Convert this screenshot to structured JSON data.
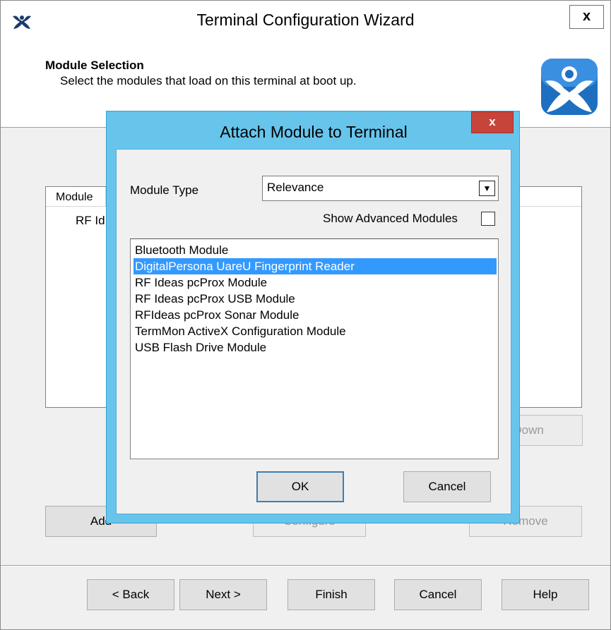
{
  "wizard": {
    "title": "Terminal Configuration Wizard",
    "close_label": "x",
    "header": {
      "title": "Module Selection",
      "subtitle": "Select the modules that load on this terminal at boot up."
    },
    "module_list": {
      "column_module": "Module",
      "rows": [
        "RF Id"
      ]
    },
    "buttons": {
      "move_down": "e Down",
      "add": "Add",
      "configure": "Configure",
      "remove": "Remove"
    },
    "footer": {
      "back": "< Back",
      "next": "Next >",
      "finish": "Finish",
      "cancel": "Cancel",
      "help": "Help"
    }
  },
  "dialog": {
    "title": "Attach Module to Terminal",
    "close_label": "x",
    "module_type_label": "Module Type",
    "module_type_value": "Relevance",
    "show_advanced_label": "Show Advanced Modules",
    "show_advanced_checked": false,
    "modules": [
      "Bluetooth Module",
      "DigitalPersona UareU Fingerprint Reader",
      "RF Ideas pcProx Module",
      "RF Ideas pcProx USB Module",
      "RFIdeas pcProx Sonar Module",
      "TermMon ActiveX Configuration Module",
      "USB Flash Drive Module"
    ],
    "selected_module": "DigitalPersona UareU Fingerprint Reader",
    "ok_label": "OK",
    "cancel_label": "Cancel"
  },
  "colors": {
    "dialog_frame": "#67c5ec",
    "close_red": "#c7443b",
    "selection": "#3399ff"
  }
}
